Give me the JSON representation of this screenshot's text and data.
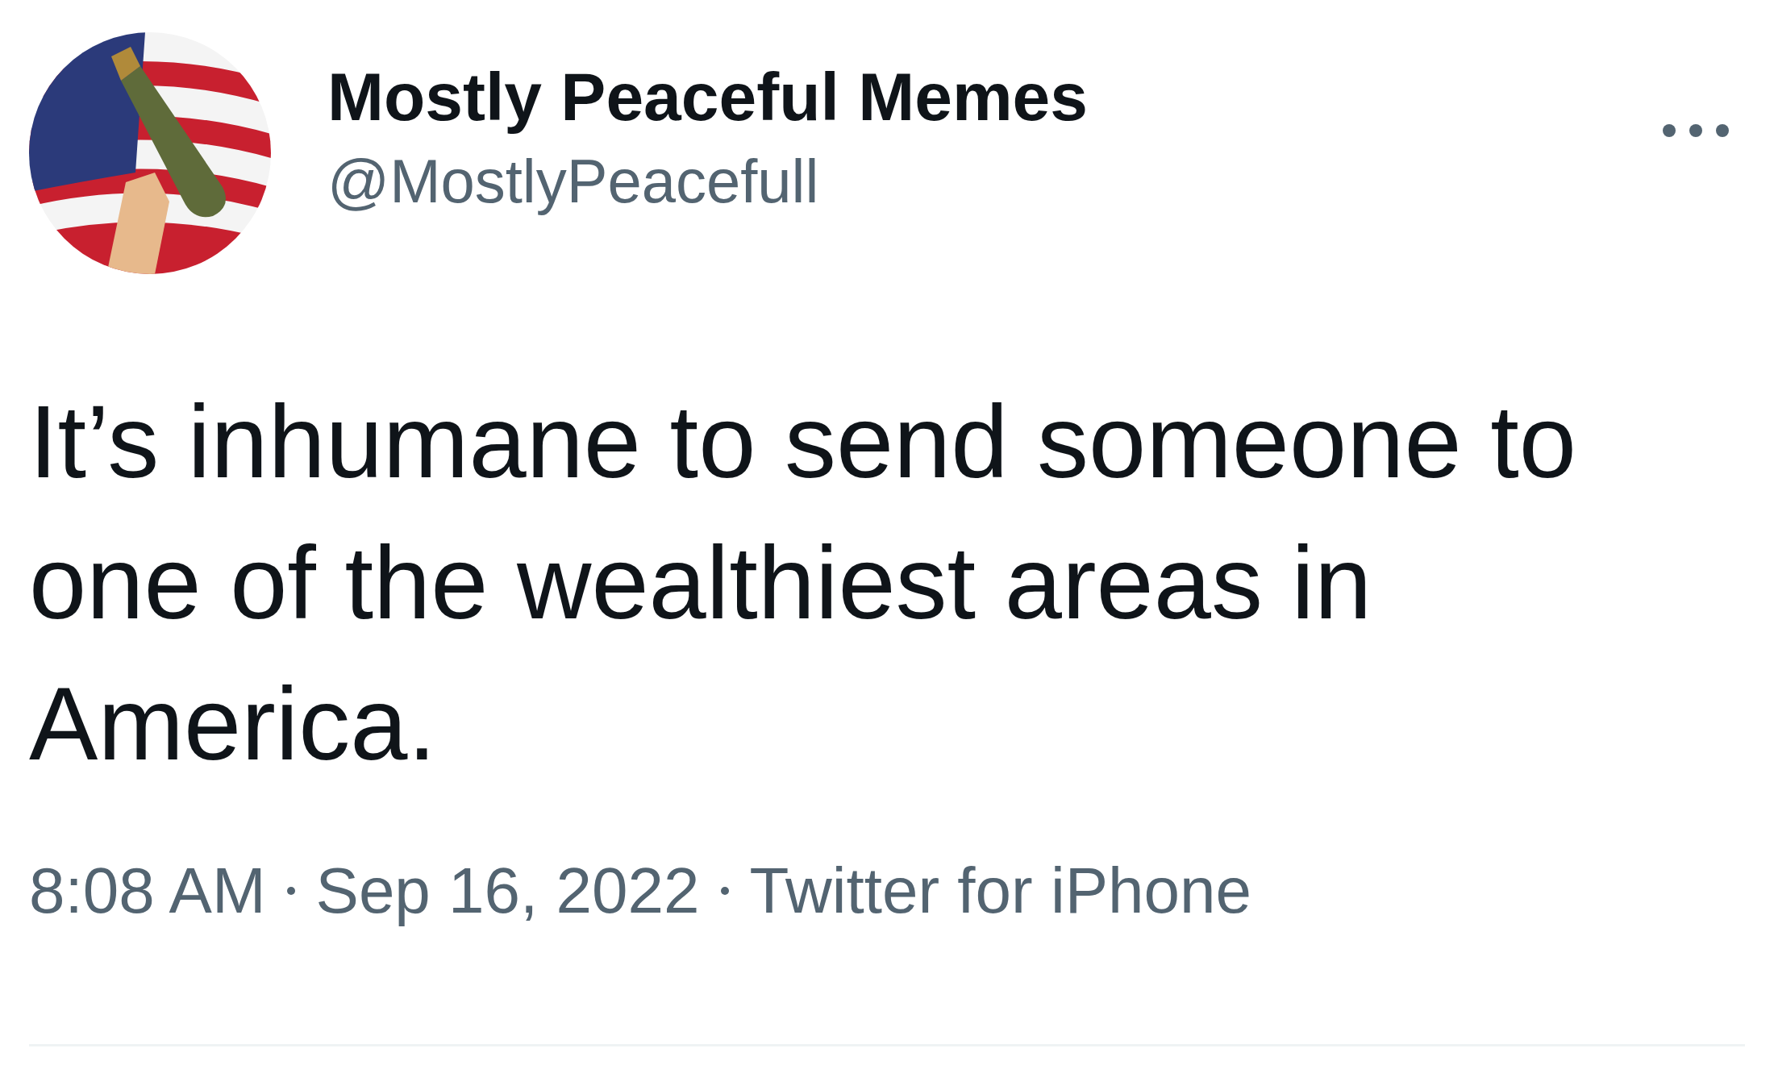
{
  "author": {
    "name": "Mostly Peaceful Memes",
    "handle": "@MostlyPeacefull"
  },
  "text": "It’s inhumane to send someone to one of the wealthiest areas in America.",
  "meta": [
    "8:08 AM",
    "Sep 16, 2022",
    "Twitter for iPhone"
  ]
}
